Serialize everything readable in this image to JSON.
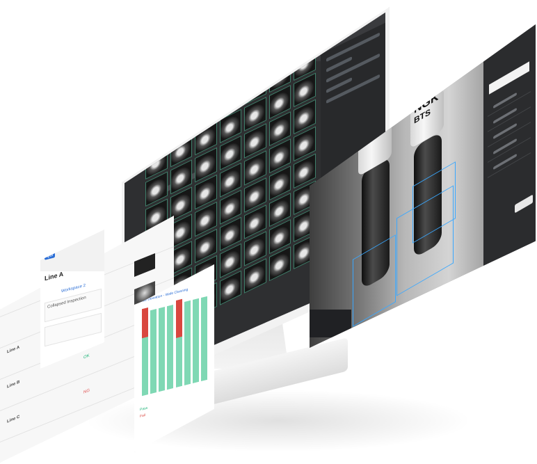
{
  "colors": {
    "screen_bg": "#2e2f31",
    "thumb_border": "#3f7f6a",
    "bbox": "#3aa8ff",
    "ok_bar": "#7fd8b4",
    "ng_bar": "#d9473f",
    "accent": "#2d6fd6"
  },
  "monitor": {
    "grid_cols": 7,
    "grid_rows": 9,
    "thumbnail_icon": "spark-plug-icon"
  },
  "inspection": {
    "brand_text": "NGK",
    "size_text": "BTS",
    "detections": 2
  },
  "mobile": {
    "badge": "Qbi",
    "title": "Line A",
    "link": "Workspace 2",
    "label": "Collapsed Inspection"
  },
  "chart_card": {
    "title": "Rice Deviation - Wafe Cleaning",
    "bars": [
      {
        "ok": 1.0,
        "ng": 0.35
      },
      {
        "ok": 1.0,
        "ng": 0.0
      },
      {
        "ok": 1.0,
        "ng": 0.0
      },
      {
        "ok": 1.0,
        "ng": 0.0
      },
      {
        "ok": 1.0,
        "ng": 0.45
      },
      {
        "ok": 1.0,
        "ng": 0.0
      },
      {
        "ok": 1.0,
        "ng": 0.0
      },
      {
        "ok": 1.0,
        "ng": 0.0
      }
    ],
    "legend_ok": "Pass",
    "legend_ng": "Fail"
  },
  "table": {
    "rows": [
      {
        "name": "Line A",
        "status": "OK"
      },
      {
        "name": "Line B",
        "status": "OK"
      },
      {
        "name": "Line C",
        "status": "NG"
      }
    ]
  }
}
